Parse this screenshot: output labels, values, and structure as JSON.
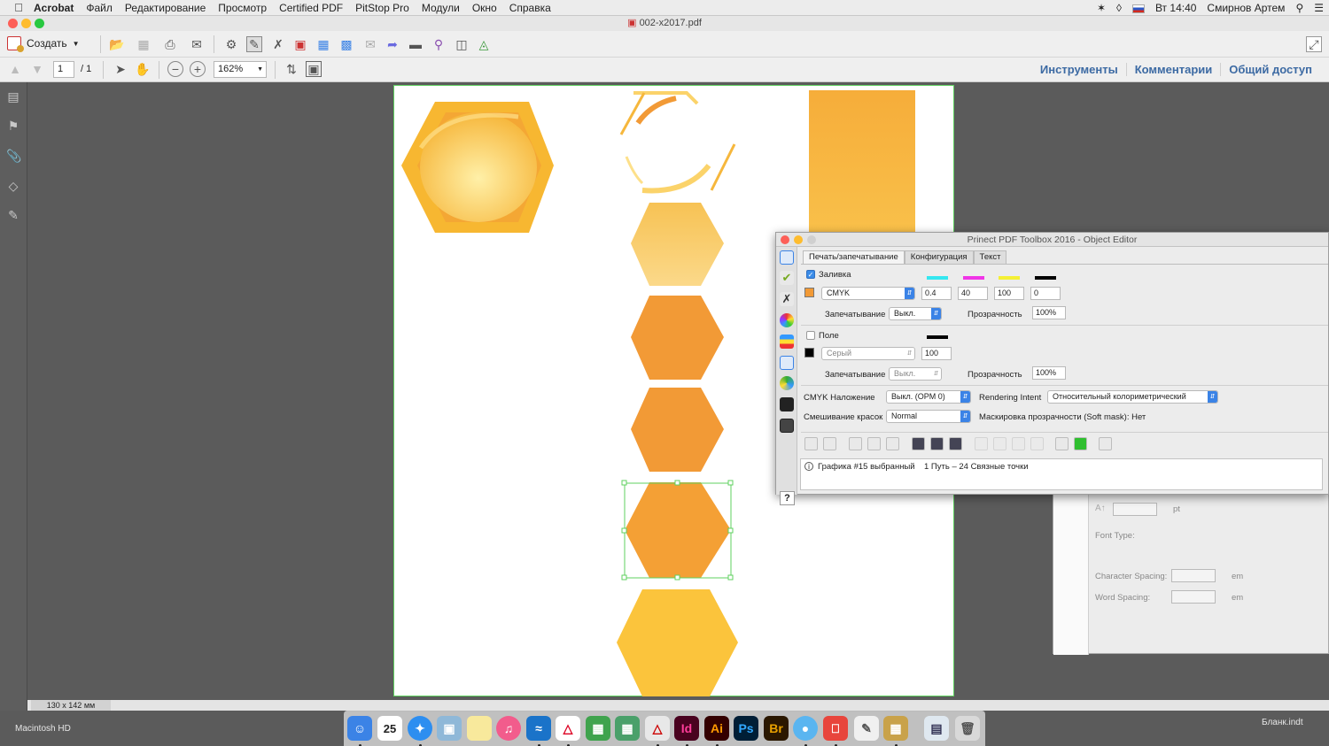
{
  "menubar": {
    "app_name": "Acrobat",
    "items": [
      "Файл",
      "Редактирование",
      "Просмотр",
      "Certified PDF",
      "PitStop Pro",
      "Модули",
      "Окно",
      "Справка"
    ],
    "clock": "Вт 14:40",
    "user": "Смирнов Артем"
  },
  "window": {
    "title": "002-x2017.pdf"
  },
  "toolbar": {
    "create_label": "Создать",
    "page_current": "1",
    "page_total": "/ 1",
    "zoom": "162%",
    "links": [
      "Инструменты",
      "Комментарии",
      "Общий доступ"
    ]
  },
  "status": {
    "page_size": "130 x 142 мм"
  },
  "colors": {
    "hex_gold": "#f7b731",
    "hex_orange": "#f29a36",
    "hex_yellow": "#fbc43c",
    "selection": "#5fd15f",
    "accent": "#3b83e6"
  },
  "object_editor": {
    "title": "Prinect PDF Toolbox 2016 - Object Editor",
    "tabs": [
      "Печать/запечатывание",
      "Конфигурация",
      "Текст"
    ],
    "fill": {
      "label": "Заливка",
      "checked": true,
      "colorspace": "CMYK",
      "c": "0.4",
      "m": "40",
      "y": "100",
      "k": "0",
      "overprint_label": "Запечатывание",
      "overprint_value": "Выкл.",
      "opacity_label": "Прозрачность",
      "opacity_value": "100%"
    },
    "stroke": {
      "label": "Поле",
      "checked": false,
      "colorspace": "Серый",
      "value": "100",
      "overprint_label": "Запечатывание",
      "overprint_value": "Выкл.",
      "opacity_label": "Прозрачность",
      "opacity_value": "100%"
    },
    "cmyk_overprint_label": "CMYK Наложение",
    "cmyk_overprint_value": "Выкл. (OPM 0)",
    "rendering_intent_label": "Rendering Intent",
    "rendering_intent_value": "Относительный колориметрический",
    "blend_label": "Смешивание красок",
    "blend_value": "Normal",
    "softmask_label": "Маскировка прозрачности (Soft mask): Нет",
    "info_selected": "Графика #15 выбранный",
    "info_path": "1 Путь – 24 Связные точки",
    "help": "?"
  },
  "text_panel": {
    "unit_pt": "pt",
    "font_type": "Font Type:",
    "char_spacing": "Character Spacing:",
    "word_spacing": "Word Spacing:",
    "unit_em": "em"
  },
  "desktop": {
    "drive": "Macintosh HD",
    "file": "Бланк.indt"
  },
  "dock": {
    "calendar_day": "25",
    "apps": [
      "Id",
      "Ai",
      "Ps",
      "Br"
    ]
  }
}
